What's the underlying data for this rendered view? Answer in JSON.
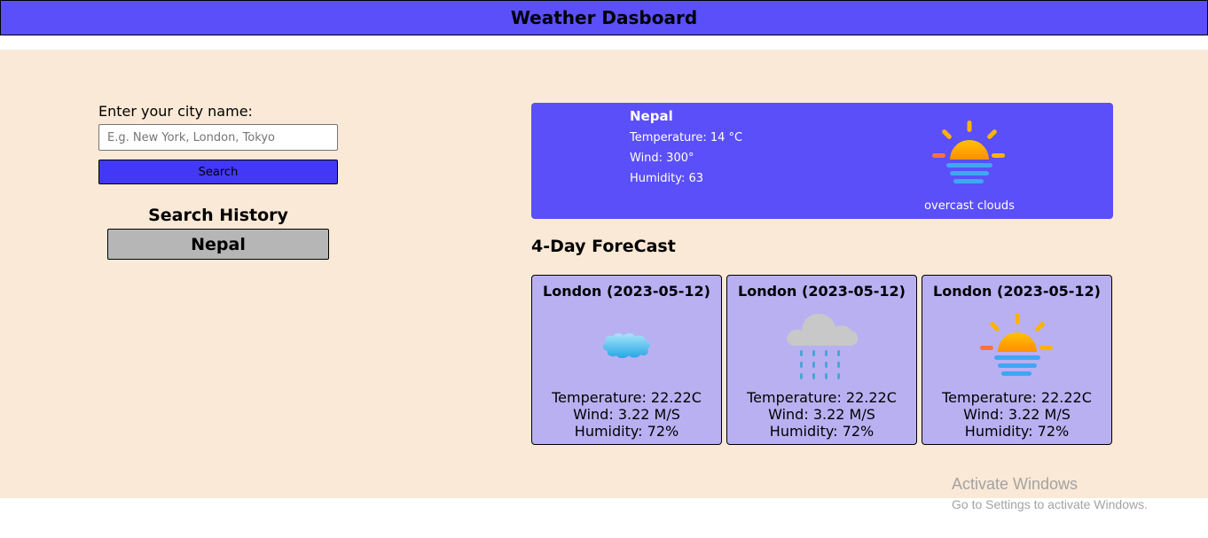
{
  "app": {
    "title": "Weather Dasboard"
  },
  "search": {
    "label": "Enter your city name:",
    "placeholder": "E.g. New York, London, Tokyo",
    "value": "",
    "button_label": "Search"
  },
  "history": {
    "title": "Search History",
    "items": [
      "Nepal"
    ]
  },
  "current": {
    "city": "Nepal",
    "temperature": "Temperature: 14 °C",
    "wind": "Wind: 300°",
    "humidity": "Humidity: 63",
    "description": "overcast clouds",
    "icon": "sun-haze-icon"
  },
  "forecast": {
    "title": "4-Day ForeCast",
    "cards": [
      {
        "title": "London (2023-05-12)",
        "icon": "cloud-icon",
        "temperature": "Temperature: 22.22C",
        "wind": "Wind: 3.22 M/S",
        "humidity": "Humidity: 72%"
      },
      {
        "title": "London (2023-05-12)",
        "icon": "rain-cloud-icon",
        "temperature": "Temperature: 22.22C",
        "wind": "Wind: 3.22 M/S",
        "humidity": "Humidity: 72%"
      },
      {
        "title": "London (2023-05-12)",
        "icon": "sun-haze-icon",
        "temperature": "Temperature: 22.22C",
        "wind": "Wind: 3.22 M/S",
        "humidity": "Humidity: 72%"
      }
    ]
  },
  "watermark": {
    "title": "Activate Windows",
    "subtitle": "Go to Settings to activate Windows."
  },
  "colors": {
    "header": "#5b4ffa",
    "background": "#fae9d6",
    "search_button": "#4338f5",
    "current_card": "#5b4ffa",
    "forecast_card": "#b9b0f2",
    "history_button": "#b6b6b6"
  }
}
